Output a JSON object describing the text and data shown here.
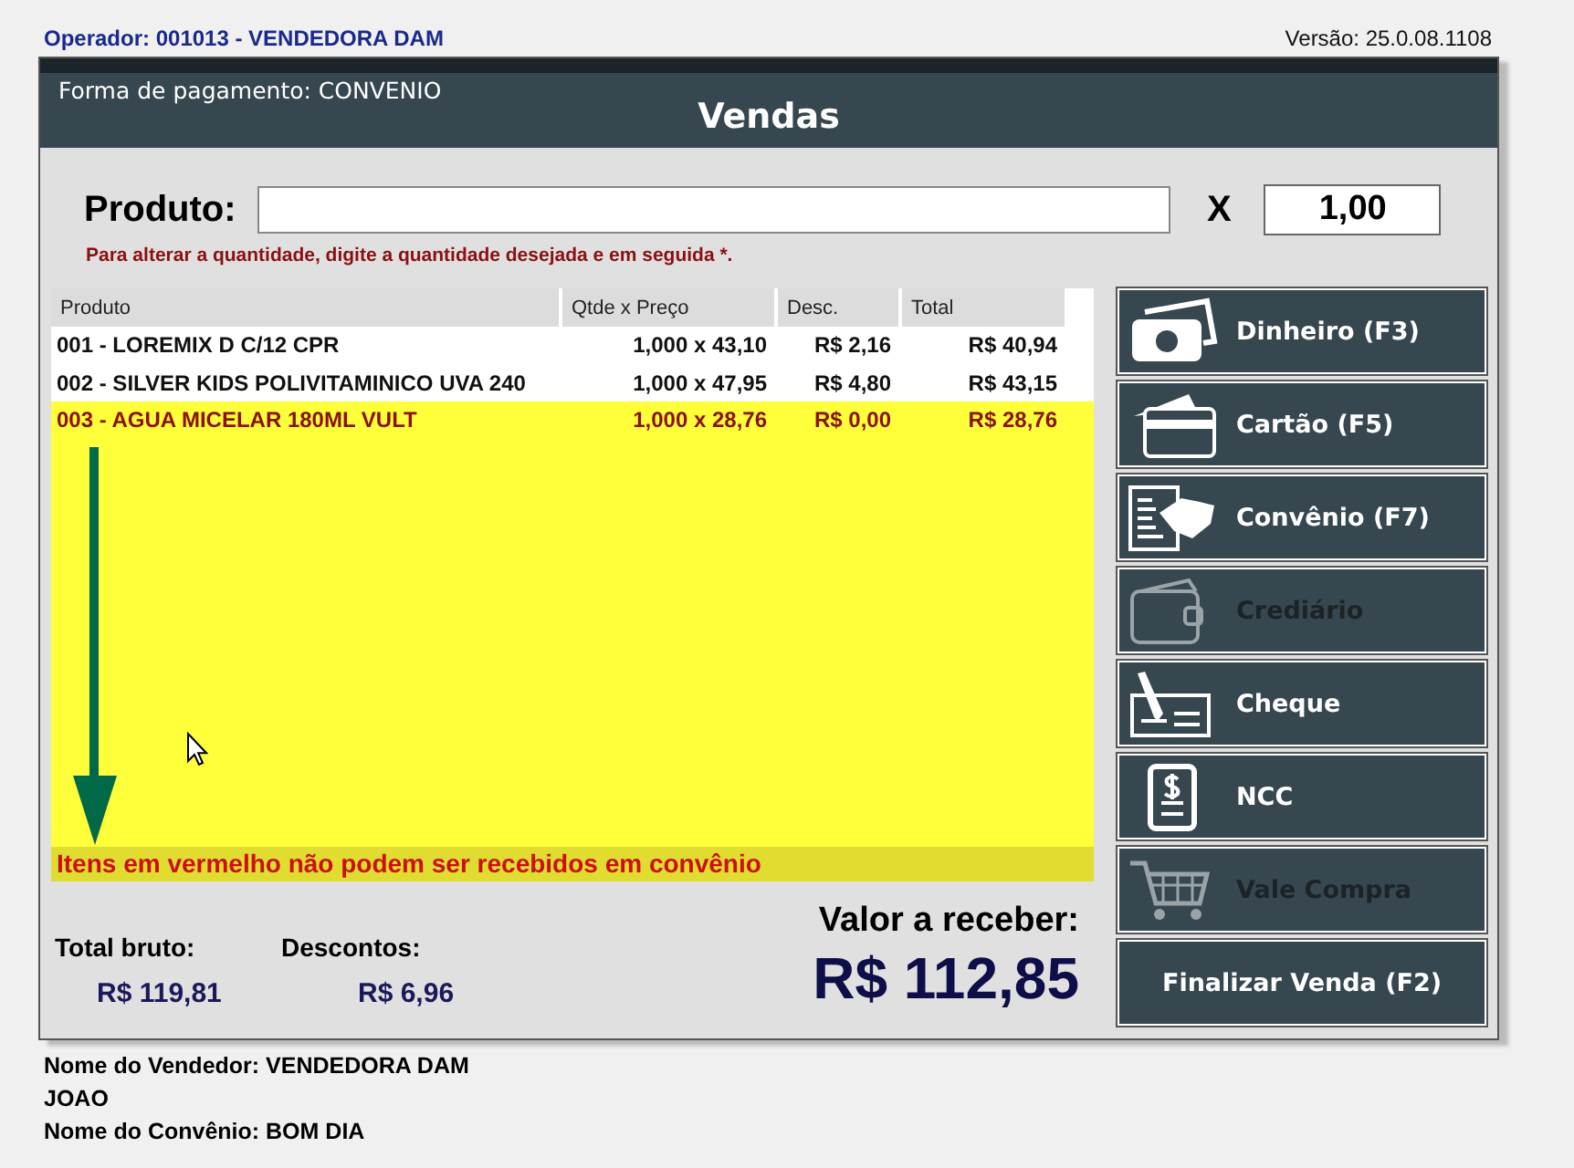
{
  "operator": "Operador: 001013 - VENDEDORA DAM",
  "version": "Versão: 25.0.08.1108",
  "header": {
    "payment_form": "Forma de pagamento: CONVENIO",
    "title": "Vendas"
  },
  "product_field": {
    "label": "Produto:",
    "times": "X",
    "quantity": "1,00"
  },
  "hint": "Para alterar a quantidade, digite a quantidade desejada e em seguida *.",
  "table": {
    "columns": [
      "Produto",
      "Qtde x Preço",
      "Desc.",
      "Total"
    ],
    "rows": [
      {
        "product": "001 - LOREMIX D C/12 CPR",
        "qty_price": "1,000 x 43,10",
        "discount": "R$ 2,16",
        "total": "R$ 40,94",
        "blocked": false
      },
      {
        "product": "002 - SILVER KIDS POLIVITAMINICO UVA 240",
        "qty_price": "1,000 x 47,95",
        "discount": "R$ 4,80",
        "total": "R$ 43,15",
        "blocked": false
      },
      {
        "product": "003 - AGUA MICELAR 180ML VULT",
        "qty_price": "1,000 x 28,76",
        "discount": "R$ 0,00",
        "total": "R$ 28,76",
        "blocked": true
      }
    ],
    "warning": "Itens em vermelho não podem ser recebidos em convênio"
  },
  "payment_buttons": [
    {
      "kind": "cash",
      "label": "Dinheiro (F3)",
      "disabled": false
    },
    {
      "kind": "card",
      "label": "Cartão (F5)",
      "disabled": false
    },
    {
      "kind": "agreement",
      "label": "Convênio (F7)",
      "disabled": false
    },
    {
      "kind": "wallet",
      "label": "Crediário",
      "disabled": true
    },
    {
      "kind": "cheque",
      "label": "Cheque",
      "disabled": false
    },
    {
      "kind": "receipt",
      "label": "NCC",
      "disabled": false
    },
    {
      "kind": "cart",
      "label": "Vale Compra",
      "disabled": true
    },
    {
      "kind": "finish",
      "label": "Finalizar Venda (F2)",
      "disabled": false
    }
  ],
  "totals": {
    "gross_label": "Total bruto:",
    "gross": "R$ 119,81",
    "discount_label": "Descontos:",
    "discount": "R$ 6,96",
    "due_label": "Valor a receber:",
    "due": "R$ 112,85"
  },
  "footer": [
    "Nome do Vendedor: VENDEDORA DAM",
    "JOAO",
    "Nome do Convênio: BOM DIA"
  ]
}
